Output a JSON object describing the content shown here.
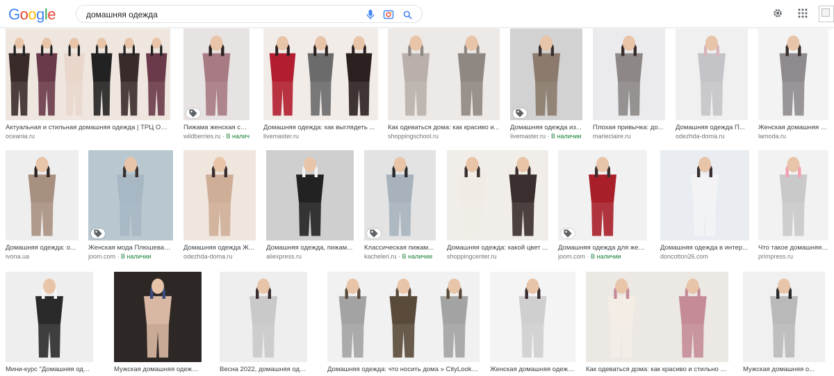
{
  "header": {
    "logo": [
      "G",
      "o",
      "o",
      "g",
      "l",
      "e"
    ],
    "logo_colors": [
      "#4285f4",
      "#ea4335",
      "#fbbc05",
      "#4285f4",
      "#34a853",
      "#ea4335"
    ],
    "query": "домашняя одежда",
    "icons": [
      "mic-icon",
      "camera-lens-icon",
      "search-icon",
      "gear-icon",
      "apps-grid-icon"
    ]
  },
  "stock_label": "В наличии",
  "colors": {
    "stock": "#188038",
    "caption": "#3c4043",
    "site": "#70757a"
  },
  "rows": [
    [
      {
        "caption": "Актуальная и стильная домашняя одежда | ТРЦ Океа...",
        "site": "oceania.ru",
        "stock": false,
        "tag": false
      },
      {
        "caption": "Пижама женская со ...",
        "site": "wildberries.ru",
        "stock": true,
        "tag": true
      },
      {
        "caption": "Домашняя одежда: как выглядеть ...",
        "site": "livemaster.ru",
        "stock": false,
        "tag": false
      },
      {
        "caption": "Как одеваться дома: как красиво и...",
        "site": "shoppingschool.ru",
        "stock": false,
        "tag": false
      },
      {
        "caption": "Домашняя одежда из...",
        "site": "livemaster.ru",
        "stock": true,
        "tag": true
      },
      {
        "caption": "Плохая привычка: до...",
        "site": "marieclaire.ru",
        "stock": false,
        "tag": false
      },
      {
        "caption": "Домашняя одежда П...",
        "site": "odezhda-doma.ru",
        "stock": false,
        "tag": false
      },
      {
        "caption": "Женская домашняя о...",
        "site": "lamoda.ru",
        "stock": false,
        "tag": false
      }
    ],
    [
      {
        "caption": "Домашняя одежда: о...",
        "site": "ivona.ua",
        "stock": false,
        "tag": false
      },
      {
        "caption": "Женская мода Плюшевая ...",
        "site": "joom.com",
        "stock": true,
        "tag": true
      },
      {
        "caption": "Домашняя одежда Ж...",
        "site": "odezhda-doma.ru",
        "stock": false,
        "tag": false
      },
      {
        "caption": "Домашняя одежда, пижам...",
        "site": "aliexpress.ru",
        "stock": false,
        "tag": false
      },
      {
        "caption": "Классическая пижам...",
        "site": "kacheleri.ru",
        "stock": true,
        "tag": true
      },
      {
        "caption": "Домашняя одежда: какой цвет ...",
        "site": "shoppingcenter.ru",
        "stock": false,
        "tag": false
      },
      {
        "caption": "Домашняя одежда для жен...",
        "site": "joom.com",
        "stock": true,
        "tag": true
      },
      {
        "caption": "Домашняя одежда в интер...",
        "site": "doncotton26.com",
        "stock": false,
        "tag": false
      },
      {
        "caption": "Что такое домашняя ...",
        "site": "primpress.ru",
        "stock": false,
        "tag": false
      }
    ],
    [
      {
        "caption": "Мини-курс \"Домашняя одеж...",
        "site": "",
        "stock": false,
        "tag": false
      },
      {
        "caption": "Мужская домашняя одежда – ...",
        "site": "",
        "stock": false,
        "tag": false
      },
      {
        "caption": "Весна 2022, домашняя одежда, ...",
        "site": "",
        "stock": false,
        "tag": false
      },
      {
        "caption": "Домашняя одежда: что носить дома » CityLook.by",
        "site": "",
        "stock": false,
        "tag": false
      },
      {
        "caption": "Женская домашняя одежда ...",
        "site": "",
        "stock": false,
        "tag": false
      },
      {
        "caption": "Как одеваться дома: как красиво и стильно одева...",
        "site": "",
        "stock": false,
        "tag": false
      },
      {
        "caption": "Мужская домашняя о...",
        "site": "",
        "stock": false,
        "tag": false
      }
    ]
  ]
}
